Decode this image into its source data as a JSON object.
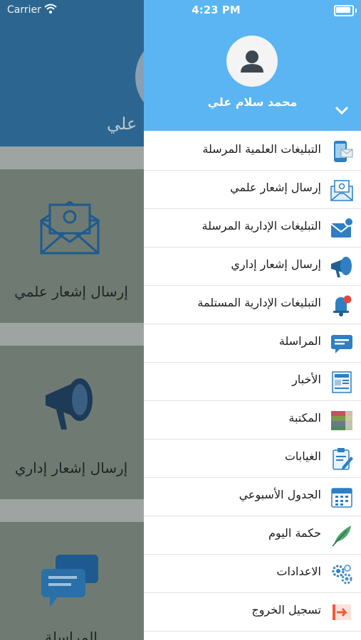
{
  "status_bar": {
    "carrier": "Carrier",
    "time": "4:23 PM"
  },
  "background": {
    "user_name_partial": "علي",
    "cards": [
      {
        "label": "إرسال إشعار علمي",
        "icon": "envelope-at-icon"
      },
      {
        "label": "إرسال إشعار إداري",
        "icon": "megaphone-icon"
      },
      {
        "label": "المراسلة",
        "icon": "chat-icon"
      }
    ]
  },
  "drawer": {
    "user_name": "محمد سلام علي",
    "menu": [
      {
        "label": "التبليغات العلمية المرسلة",
        "icon": "phone-mail-icon"
      },
      {
        "label": "إرسال إشعار علمي",
        "icon": "envelope-at-icon"
      },
      {
        "label": "التبليغات الإدارية المرسلة",
        "icon": "mail-badge-icon"
      },
      {
        "label": "إرسال إشعار إداري",
        "icon": "megaphone-icon"
      },
      {
        "label": "التبليغات الإدارية المستلمة",
        "icon": "bell-icon"
      },
      {
        "label": "المراسلة",
        "icon": "chat-icon"
      },
      {
        "label": "الأخبار",
        "icon": "newspaper-icon"
      },
      {
        "label": "المكتبة",
        "icon": "books-icon"
      },
      {
        "label": "الغيابات",
        "icon": "clipboard-icon"
      },
      {
        "label": "الجدول الأسبوعي",
        "icon": "calendar-icon"
      },
      {
        "label": "حكمة اليوم",
        "icon": "feather-icon"
      },
      {
        "label": "الاعدادات",
        "icon": "gears-icon"
      },
      {
        "label": "تسجيل الخروج",
        "icon": "logout-icon"
      }
    ]
  },
  "colors": {
    "drawer_header": "#5ab5f2",
    "background_header": "#2c6690"
  }
}
